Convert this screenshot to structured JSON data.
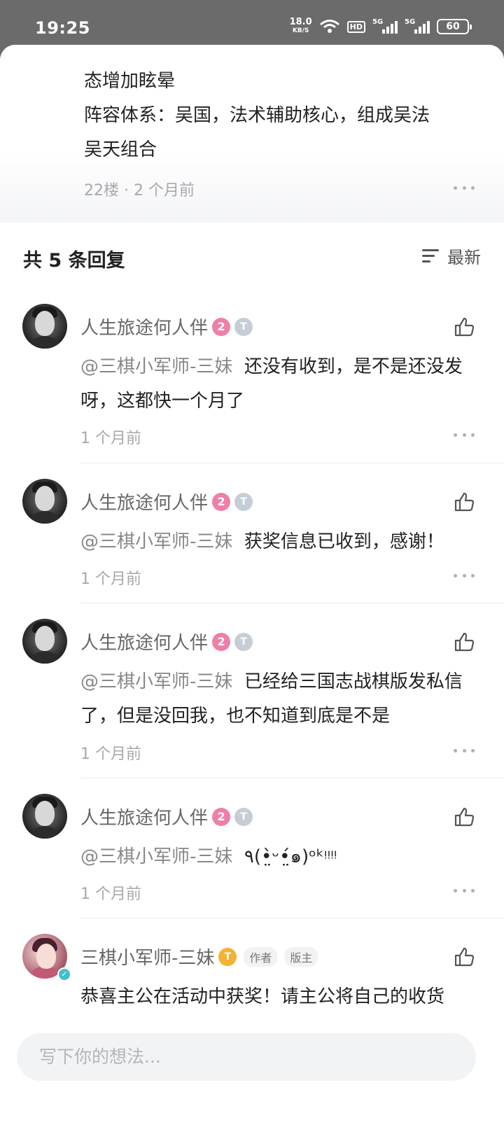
{
  "status_bar": {
    "time": "19:25",
    "net_speed": "18.0",
    "net_unit": "KB/S",
    "hd": "HD",
    "sig1": "5G",
    "sig2": "5G",
    "battery": "60"
  },
  "main_post": {
    "lines": [
      "态增加眩晕",
      "阵容体系：吴国，法术辅助核心，组成吴法",
      "吴天组合"
    ],
    "meta": "22楼 · 2 个月前"
  },
  "replies_header": {
    "count_label": "共 5 条回复",
    "sort_label": "最新"
  },
  "replies": [
    {
      "username": "人生旅途何人伴",
      "level": "2",
      "tier": "T",
      "mention": "@三棋小军师-三妹",
      "text": "还没有收到，是不是还没发呀，这都快一个月了",
      "time": "1 个月前"
    },
    {
      "username": "人生旅途何人伴",
      "level": "2",
      "tier": "T",
      "mention": "@三棋小军师-三妹",
      "text": "获奖信息已收到，感谢！",
      "time": "1 个月前"
    },
    {
      "username": "人生旅途何人伴",
      "level": "2",
      "tier": "T",
      "mention": "@三棋小军师-三妹",
      "text": "已经给三国志战棋版发私信了，但是没回我，也不知道到底是不是",
      "time": "1 个月前"
    },
    {
      "username": "人生旅途何人伴",
      "level": "2",
      "tier": "T",
      "mention": "@三棋小军师-三妹",
      "text": "٩(•̤̀ᵕ•̤́๑)ᵒᵏᵎᵎᵎᵎ",
      "time": "1 个月前"
    },
    {
      "username": "三棋小军师-三妹",
      "tier": "T",
      "tag_author": "作者",
      "tag_mod": "版主",
      "text": "恭喜主公在活动中获奖！请主公将自己的收货"
    }
  ],
  "input": {
    "placeholder": "写下你的想法..."
  },
  "colors": {
    "level_badge": "#ee7fa8",
    "author_badge": "#f2b233",
    "verified": "#3fc1c9"
  }
}
